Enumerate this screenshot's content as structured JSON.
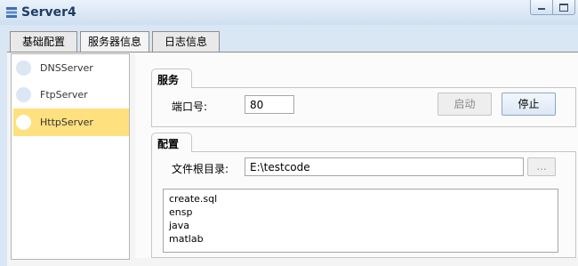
{
  "window": {
    "title": "Server4"
  },
  "tabs": [
    "基础配置",
    "服务器信息",
    "日志信息"
  ],
  "servers": [
    {
      "label": "DNSServer",
      "selected": false
    },
    {
      "label": "FtpServer",
      "selected": false
    },
    {
      "label": "HttpServer",
      "selected": true
    }
  ],
  "service": {
    "section_title": "服务",
    "port_label": "端口号:",
    "port_value": "80",
    "start_label": "启动",
    "stop_label": "停止"
  },
  "config": {
    "section_title": "配置",
    "root_label": "文件根目录:",
    "root_value": "E:\\testcode",
    "browse_label": "...",
    "files": [
      "create.sql",
      "ensp",
      "java",
      "matlab"
    ]
  },
  "colors": {
    "selected_row": "#ffe07f",
    "title_text": "#1f3d66"
  }
}
